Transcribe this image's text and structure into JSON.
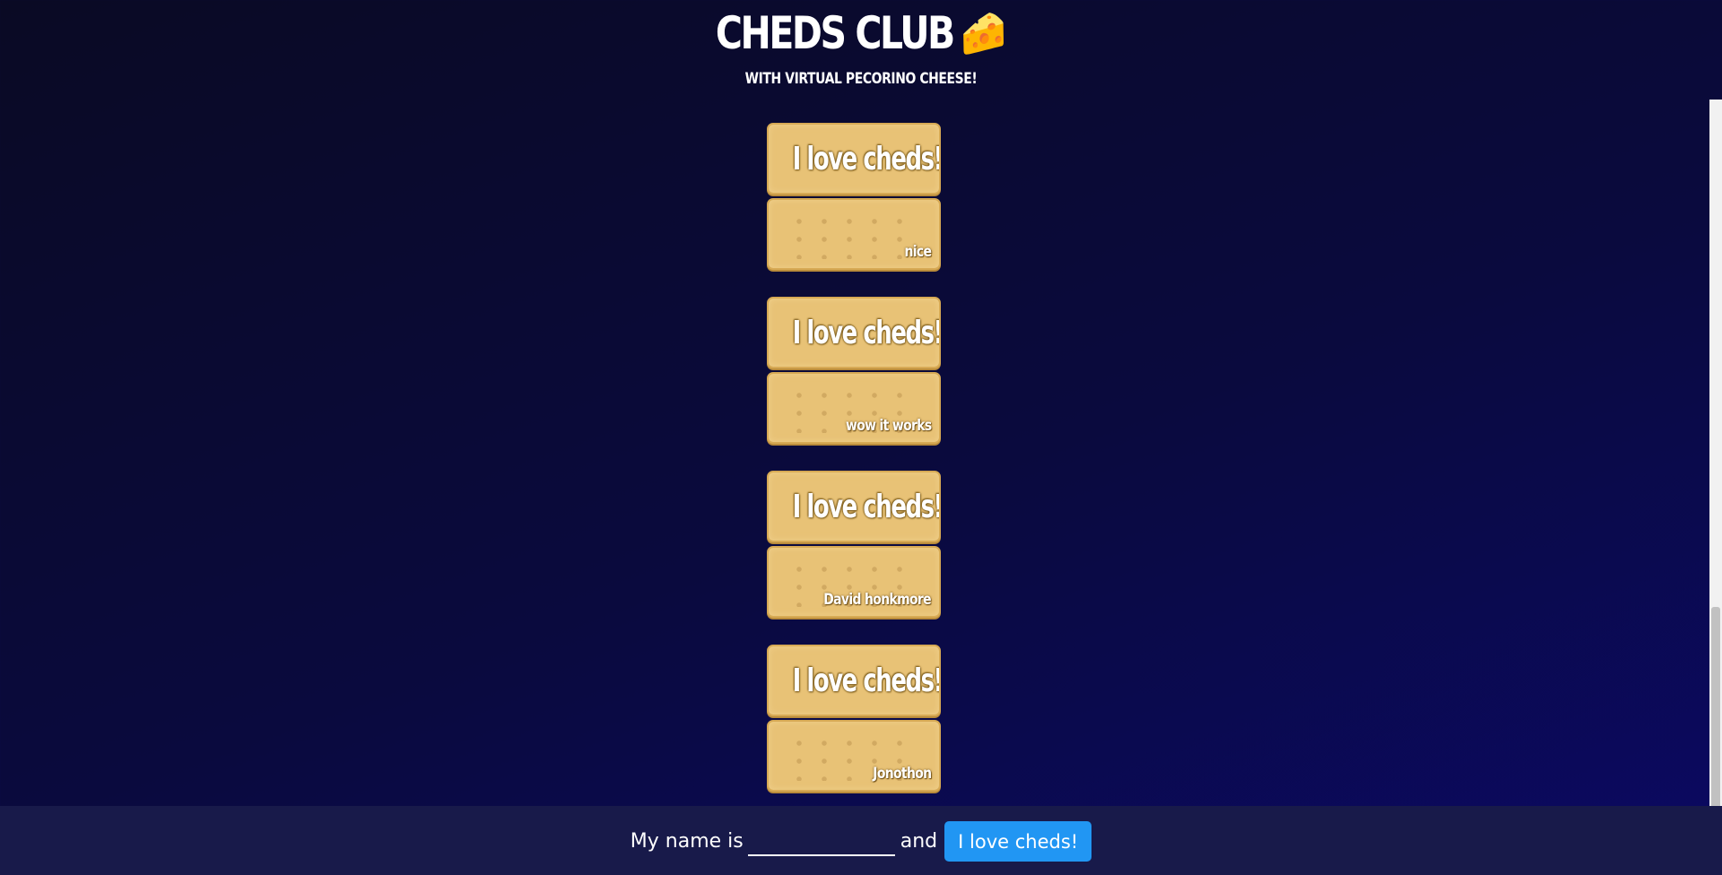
{
  "header": {
    "title": "CHEDS CLUB",
    "title_emoji": "🧀",
    "subtitle": "WITH VIRTUAL PECORINO CHEESE!"
  },
  "feed": {
    "items": [
      {
        "message": "I love cheds!",
        "name": "nice"
      },
      {
        "message": "I love cheds!",
        "name": "wow it works"
      },
      {
        "message": "I love cheds!",
        "name": "David honkmore"
      },
      {
        "message": "I love cheds!",
        "name": "Jonothon"
      }
    ]
  },
  "form": {
    "prefix": "My name is",
    "name_value": "",
    "conjunction": "and",
    "submit_label": "I love cheds!"
  },
  "colors": {
    "background": "#0a0a3e",
    "cracker": "#e8c276",
    "footer": "#181a4a",
    "button": "#2196f3"
  }
}
